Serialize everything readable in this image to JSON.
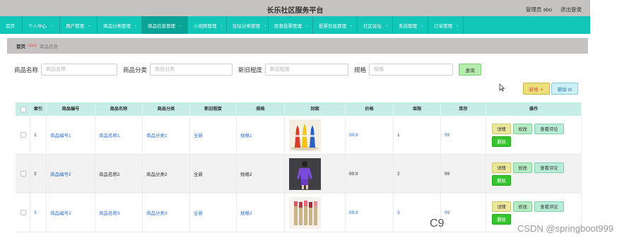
{
  "header": {
    "title": "长乐社区服务平台",
    "user": "管理员 abo",
    "logout": "退出登录"
  },
  "nav": [
    {
      "label": "首页",
      "chev": false,
      "w": 32,
      "active": false
    },
    {
      "label": "个人中心",
      "chev": true,
      "w": 53,
      "active": false
    },
    {
      "label": "用户管理",
      "chev": true,
      "w": 53,
      "active": false
    },
    {
      "label": "商品分类管理",
      "chev": true,
      "w": 63,
      "active": false
    },
    {
      "label": "商品信息管理",
      "chev": true,
      "w": 65,
      "active": true
    },
    {
      "label": "小视频管理",
      "chev": true,
      "w": 55,
      "active": false
    },
    {
      "label": "论坛分类管理",
      "chev": true,
      "w": 59,
      "active": false
    },
    {
      "label": "民意投票管理",
      "chev": true,
      "w": 63,
      "active": false
    },
    {
      "label": "投票信息管理",
      "chev": true,
      "w": 63,
      "active": false
    },
    {
      "label": "社区论坛",
      "chev": true,
      "w": 50,
      "active": false
    },
    {
      "label": "系统管理",
      "chev": true,
      "w": 50,
      "active": false
    },
    {
      "label": "订单管理",
      "chev": true,
      "w": 50,
      "active": false
    }
  ],
  "breadcrumb": {
    "home": "首页",
    "sep": "cccc",
    "current": "商品信息"
  },
  "search": {
    "name_label": "商品名称",
    "name_placeholder": "商品名称",
    "category_label": "商品分类",
    "category_placeholder": "商品分类",
    "condition_label": "新旧程度",
    "condition_placeholder": "新旧程度",
    "spec_label": "规格",
    "spec_placeholder": "规格",
    "button": "查询"
  },
  "actions": {
    "add": "新增 ＋",
    "delete": "删除 ⊟"
  },
  "table": {
    "columns": [
      "",
      "索引",
      "商品编号",
      "商品名称",
      "商品分类",
      "新旧程度",
      "规格",
      "封面",
      "价格",
      "单限",
      "库存",
      "操作"
    ],
    "rows": [
      {
        "index": "1",
        "code": "商品编号1",
        "name": "商品名称1",
        "category": "商品分类1",
        "condition": "全新",
        "spec": "规格1",
        "cover": "bottles",
        "price": "99.9",
        "limit": "1",
        "stock": "99"
      },
      {
        "index": "2",
        "code": "商品编号2",
        "name": "商品名称2",
        "category": "商品分类2",
        "condition": "全新",
        "spec": "规格2",
        "cover": "dress",
        "price": "99.9",
        "limit": "2",
        "stock": "99"
      },
      {
        "index": "3",
        "code": "商品编号3",
        "name": "商品名称3",
        "category": "商品分类3",
        "condition": "全新",
        "spec": "规格3",
        "cover": "lipstick",
        "price": "99.9",
        "limit": "3",
        "stock": "99"
      }
    ],
    "ops": {
      "detail": "详情",
      "edit": "修改",
      "review": "查看评论",
      "remove": "删除"
    }
  },
  "watermark": "CSDN @springboot999",
  "overlay_fragment": "C9"
}
